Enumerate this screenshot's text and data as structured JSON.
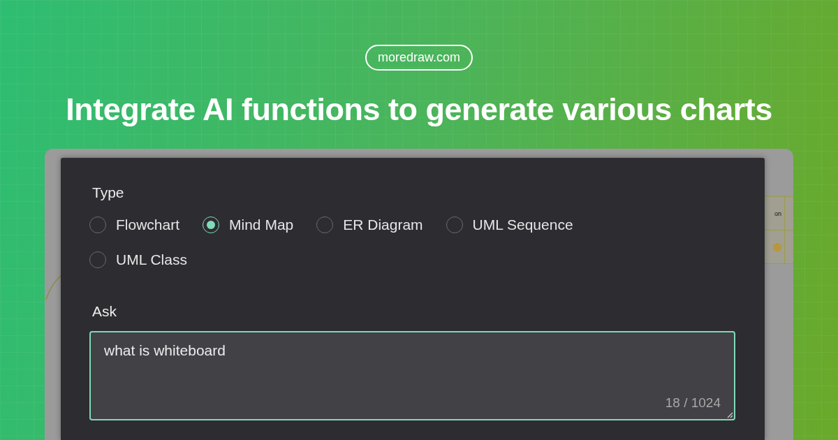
{
  "site_badge": "moredraw.com",
  "headline": "Integrate AI functions to generate various charts",
  "canvas": {
    "table_cell_text": "on"
  },
  "dialog": {
    "type_label": "Type",
    "types": [
      {
        "label": "Flowchart",
        "selected": false
      },
      {
        "label": "Mind Map",
        "selected": true
      },
      {
        "label": "ER Diagram",
        "selected": false
      },
      {
        "label": "UML Sequence",
        "selected": false
      },
      {
        "label": "UML Class",
        "selected": false
      }
    ],
    "ask_label": "Ask",
    "ask_value": "what is whiteboard",
    "char_count": "18 / 1024"
  }
}
